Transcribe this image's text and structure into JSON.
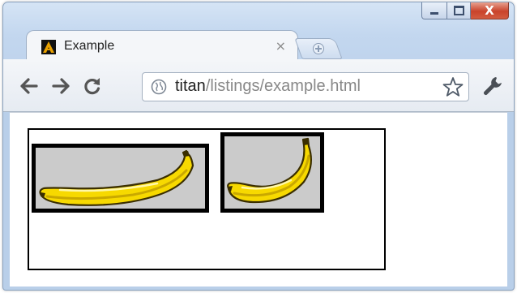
{
  "window": {
    "caption_buttons": [
      "minimize",
      "maximize",
      "close"
    ],
    "close_color": "#c9432b"
  },
  "tab": {
    "title": "Example",
    "close_glyph": "×",
    "favicon": "letter-a-icon"
  },
  "toolbar": {
    "back_icon": "arrow-left-icon",
    "forward_icon": "arrow-right-icon",
    "reload_icon": "reload-icon",
    "url_host": "titan",
    "url_path": "/listings/example.html",
    "bookmark_icon": "star-icon",
    "menu_icon": "wrench-icon"
  },
  "page": {
    "images": [
      {
        "name": "banana",
        "icon": "banana-image"
      },
      {
        "name": "banana",
        "icon": "banana-image"
      }
    ],
    "colors": {
      "banana_yellow": "#f7d900",
      "image_background": "#cbcbcb",
      "border": "#000000"
    }
  }
}
